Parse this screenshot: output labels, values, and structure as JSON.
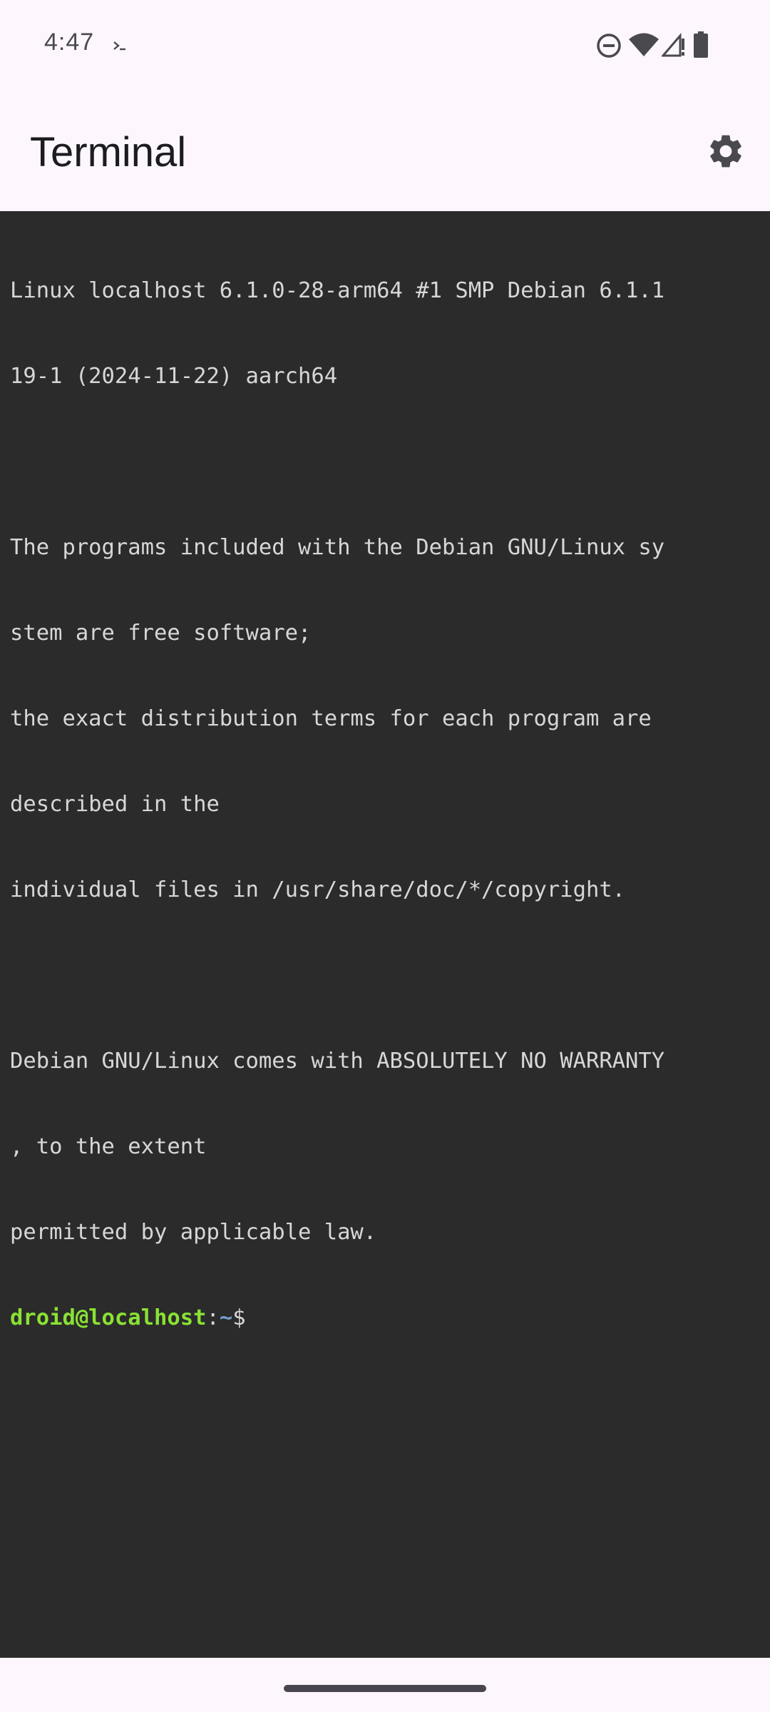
{
  "status_bar": {
    "time": "4:47",
    "icons": [
      "terminal-notification-icon",
      "do-not-disturb-icon",
      "wifi-icon",
      "cellular-signal-icon",
      "battery-icon"
    ]
  },
  "app_bar": {
    "title": "Terminal",
    "settings_icon": "gear-icon"
  },
  "terminal": {
    "lines": [
      "Linux localhost 6.1.0-28-arm64 #1 SMP Debian 6.1.1",
      "19-1 (2024-11-22) aarch64",
      "",
      "The programs included with the Debian GNU/Linux sy",
      "stem are free software;",
      "the exact distribution terms for each program are",
      "described in the",
      "individual files in /usr/share/doc/*/copyright.",
      "",
      "Debian GNU/Linux comes with ABSOLUTELY NO WARRANTY",
      ", to the extent",
      "permitted by applicable law."
    ],
    "prompt": {
      "user_host": "droid@localhost",
      "separator": ":",
      "path": "~",
      "symbol": "$"
    }
  },
  "colors": {
    "background": "#fdf7fd",
    "terminal_background": "#2b2b2b",
    "terminal_text": "#d7d7d7",
    "prompt_user": "#8ae234",
    "prompt_path": "#729fcf"
  }
}
